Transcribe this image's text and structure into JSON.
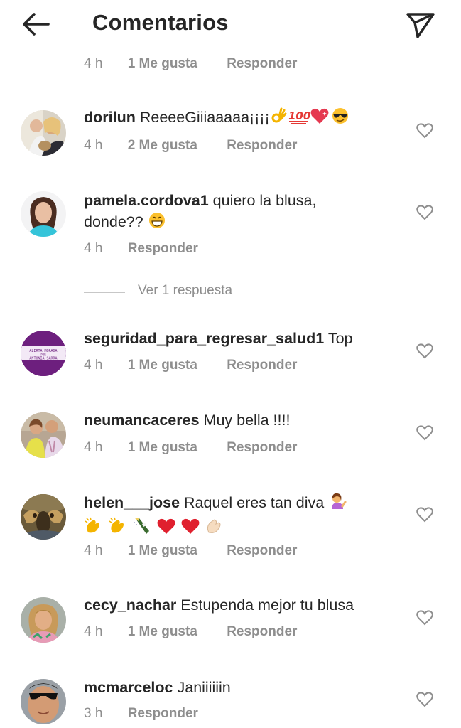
{
  "header": {
    "title": "Comentarios",
    "back_icon": "arrow-left-icon",
    "send_icon": "paper-plane-icon"
  },
  "top_meta": {
    "time": "4 h",
    "likes": "1 Me gusta",
    "reply": "Responder"
  },
  "replies_toggle": "Ver 1 respuesta",
  "comments": [
    {
      "username": "dorilun",
      "text": "ReeeeGiiiaaaaa¡¡¡¡",
      "emojis": [
        "ok-hand",
        "hundred",
        "sparkling-heart",
        "sunglasses-face"
      ],
      "time": "4 h",
      "likes": "2 Me gusta",
      "reply": "Responder"
    },
    {
      "username": "pamela.cordova1",
      "text": "quiero la blusa,",
      "text2": "donde??",
      "emojis": [
        "grinning-face"
      ],
      "time": "4 h",
      "reply": "Responder"
    },
    {
      "username": "seguridad_para_regresar_salud1",
      "text": "Top",
      "avatar_text": "ALERTA MORADA POR ANTONIA SARRA",
      "time": "4 h",
      "likes": "1 Me gusta",
      "reply": "Responder"
    },
    {
      "username": "neumancaceres",
      "text": "Muy bella !!!!",
      "time": "4 h",
      "likes": "1 Me gusta",
      "reply": "Responder"
    },
    {
      "username": "helen___jose",
      "text": "Raquel eres tan diva",
      "emojis": [
        "woman-tipping-hand",
        "clapping-hands",
        "clapping-hands",
        "champagne",
        "red-heart",
        "red-heart",
        "clapping-hands-light"
      ],
      "time": "4 h",
      "likes": "1 Me gusta",
      "reply": "Responder"
    },
    {
      "username": "cecy_nachar",
      "text": "Estupenda mejor tu blusa",
      "time": "4 h",
      "likes": "1 Me gusta",
      "reply": "Responder"
    },
    {
      "username": "mcmarceloc",
      "text": "Janiiiiiin",
      "time": "3 h",
      "reply": "Responder"
    }
  ],
  "colors": {
    "text": "#262626",
    "secondary": "#8e8e8e",
    "background": "#ffffff"
  }
}
